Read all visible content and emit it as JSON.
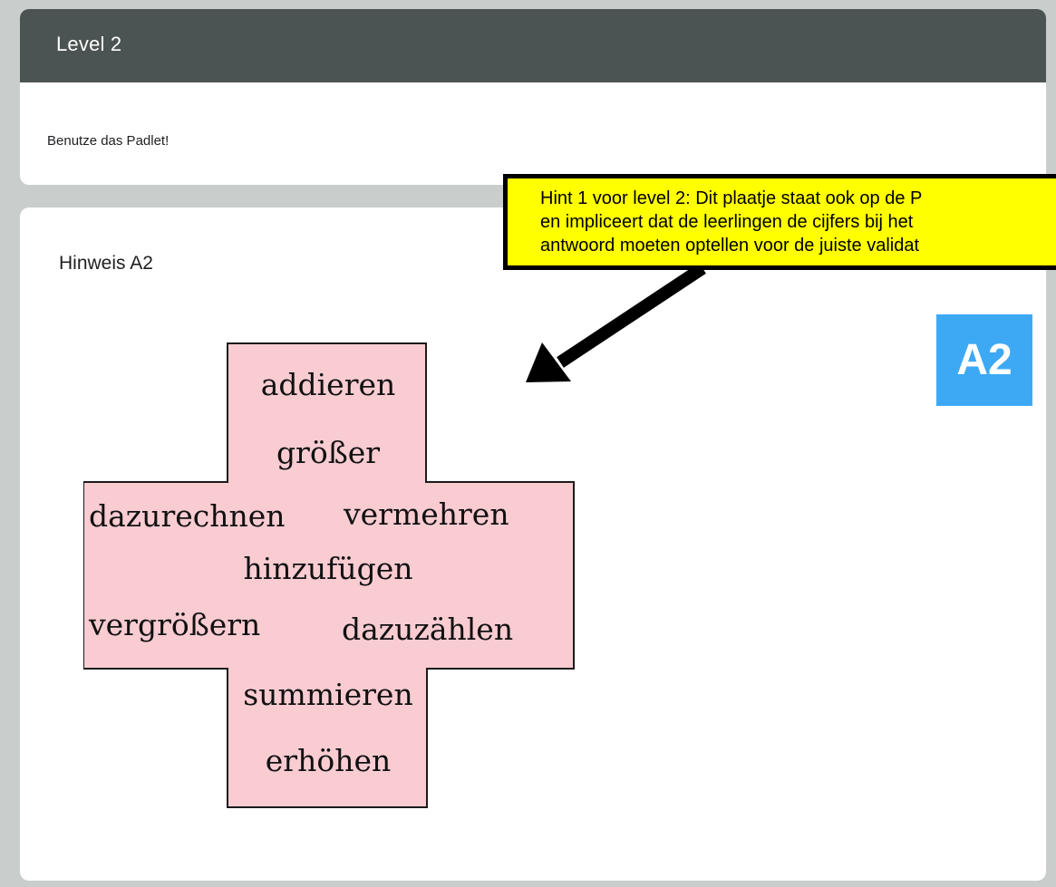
{
  "section": {
    "title": "Level 2",
    "description": "Benutze das Padlet!"
  },
  "hint_card": {
    "title": "Hinweis A2",
    "badge": "A2",
    "badge_color": "#3da9f5",
    "cross_color": "#f9ccd2",
    "cross_words": [
      "addieren",
      "größer",
      "dazurechnen",
      "vermehren",
      "hinzufügen",
      "vergrößern",
      "dazuzählen",
      "summieren",
      "erhöhen"
    ]
  },
  "annotation": {
    "lines": [
      "Hint 1 voor level 2: Dit plaatje staat ook op de P",
      "en impliceert dat de leerlingen de cijfers bij het",
      "antwoord moeten optellen voor de juiste validat"
    ],
    "background": "#ffff00"
  }
}
